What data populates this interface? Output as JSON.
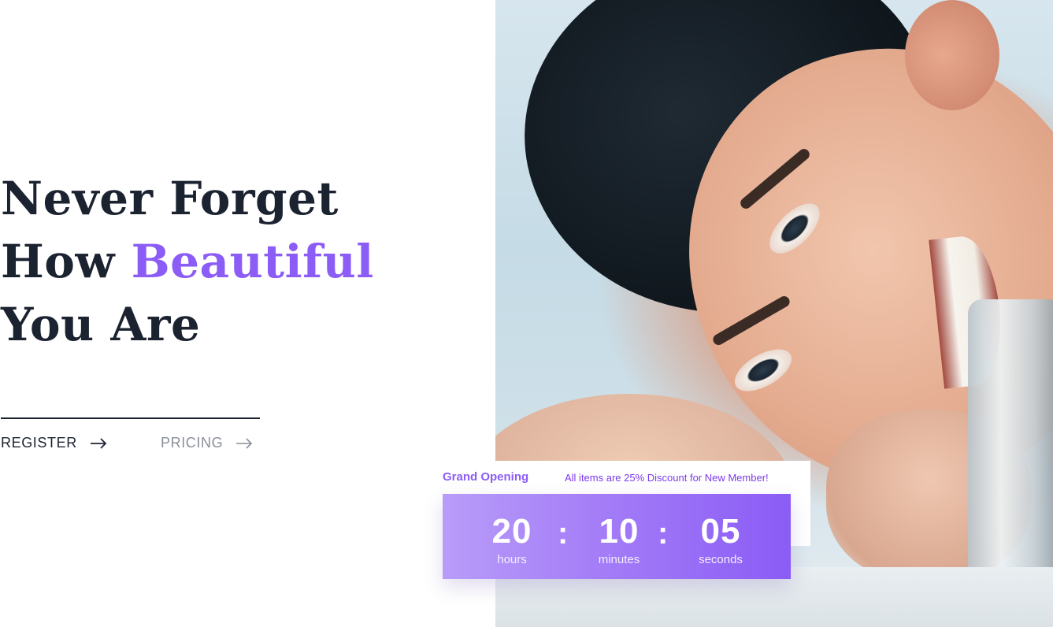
{
  "hero": {
    "headline": {
      "line1": "Never Forget",
      "line2_prefix": "How",
      "line2_accent": "Beautiful",
      "line3": "You Are"
    },
    "accent_color": "#8b5cf6",
    "text_color": "#1b2230",
    "image_description_icon": "hero-photo"
  },
  "cta": {
    "register_label": "REGISTER",
    "pricing_label": "PRICING",
    "arrow_icon": "arrow-right-icon"
  },
  "promo": {
    "title": "Grand Opening",
    "subtitle": "All items are 25% Discount for New Member!",
    "countdown": {
      "hours_value": "20",
      "hours_label": "hours",
      "separator": ":",
      "minutes_value": "10",
      "minutes_label": "minutes",
      "seconds_value": "05",
      "seconds_label": "seconds"
    },
    "gradient_start": "#b89cf9",
    "gradient_end": "#8b5cf6"
  }
}
